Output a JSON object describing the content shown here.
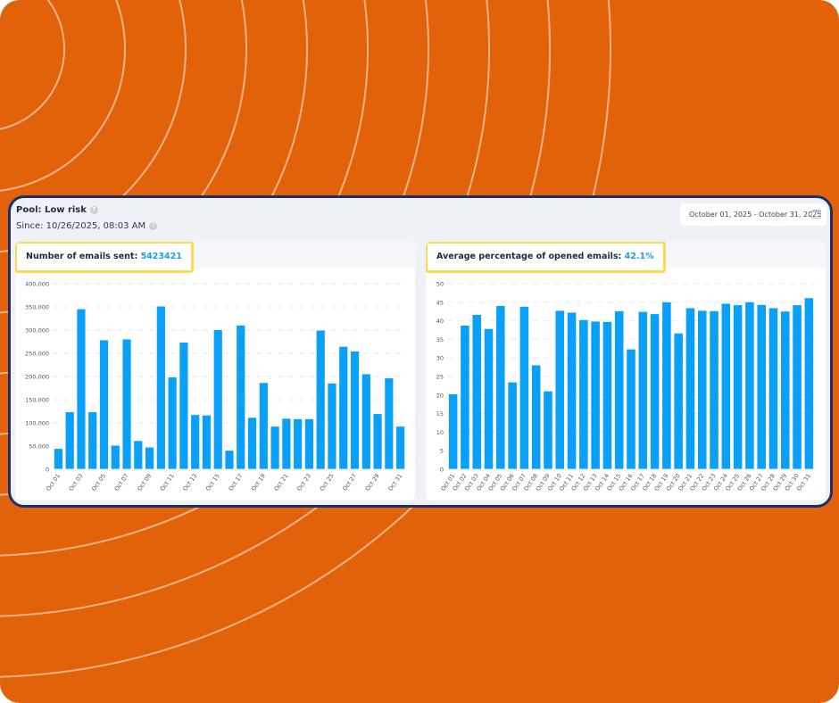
{
  "header": {
    "pool_label": "Pool: Low risk",
    "since_label": "Since: 10/26/2025, 08:03 AM",
    "help_icon_glyph": "?",
    "date_range": "October 01, 2025 - October 31, 2025"
  },
  "colors": {
    "accent": "#1AA1F0",
    "bar": "#0AA0F7",
    "background": "#E2620A",
    "frame": "#1B2F6B",
    "highlight": "#FDD94F"
  },
  "cards": {
    "sent": {
      "title": "Number of emails sent:",
      "value": "5423421"
    },
    "opened": {
      "title": "Average percentage of opened emails:",
      "value": "42.1%"
    }
  },
  "chart_data": [
    {
      "type": "bar",
      "title": "Number of emails sent",
      "categories": [
        "Oct 01",
        "Oct 02",
        "Oct 03",
        "Oct 04",
        "Oct 05",
        "Oct 06",
        "Oct 07",
        "Oct 08",
        "Oct 09",
        "Oct 10",
        "Oct 11",
        "Oct 12",
        "Oct 13",
        "Oct 14",
        "Oct 15",
        "Oct 16",
        "Oct 17",
        "Oct 18",
        "Oct 19",
        "Oct 20",
        "Oct 21",
        "Oct 22",
        "Oct 23",
        "Oct 24",
        "Oct 25",
        "Oct 26",
        "Oct 27",
        "Oct 28",
        "Oct 29",
        "Oct 30",
        "Oct 31"
      ],
      "values": [
        44000,
        123000,
        345000,
        123000,
        278000,
        51000,
        280000,
        61000,
        47000,
        351000,
        198000,
        273000,
        117000,
        116000,
        300000,
        40000,
        310000,
        111000,
        186000,
        92000,
        109000,
        108000,
        108000,
        299000,
        185000,
        264000,
        254000,
        205000,
        119000,
        196000,
        92000
      ],
      "label_every": 2,
      "yticks": [
        0,
        50000,
        100000,
        150000,
        200000,
        250000,
        300000,
        350000,
        400000
      ],
      "ytick_labels": [
        "0",
        "50,000",
        "100,000",
        "150,000",
        "200,000",
        "250,000",
        "300,000",
        "350,000",
        "400,000"
      ],
      "ylim": [
        0,
        400000
      ],
      "grid": true
    },
    {
      "type": "bar",
      "title": "Average percentage of opened emails",
      "categories": [
        "Oct 01",
        "Oct 02",
        "Oct 03",
        "Oct 04",
        "Oct 05",
        "Oct 06",
        "Oct 07",
        "Oct 08",
        "Oct 09",
        "Oct 10",
        "Oct 11",
        "Oct 12",
        "Oct 13",
        "Oct 14",
        "Oct 15",
        "Oct 16",
        "Oct 17",
        "Oct 18",
        "Oct 19",
        "Oct 20",
        "Oct 21",
        "Oct 22",
        "Oct 23",
        "Oct 24",
        "Oct 25",
        "Oct 26",
        "Oct 27",
        "Oct 28",
        "Oct 29",
        "Oct 30",
        "Oct 31"
      ],
      "values": [
        20.2,
        38.7,
        41.6,
        37.8,
        44.0,
        23.4,
        43.8,
        28.0,
        21.0,
        42.7,
        42.2,
        40.2,
        39.8,
        39.7,
        42.6,
        32.3,
        42.4,
        41.8,
        45.0,
        36.6,
        43.4,
        42.7,
        42.6,
        44.6,
        44.2,
        45.0,
        44.3,
        43.4,
        42.5,
        44.2,
        46.1
      ],
      "label_every": 1,
      "yticks": [
        0,
        5,
        10,
        15,
        20,
        25,
        30,
        35,
        40,
        45,
        50
      ],
      "ytick_labels": [
        "0",
        "5",
        "10",
        "15",
        "20",
        "25",
        "30",
        "35",
        "40",
        "45",
        "50"
      ],
      "ylim": [
        0,
        50
      ],
      "grid": true
    }
  ]
}
